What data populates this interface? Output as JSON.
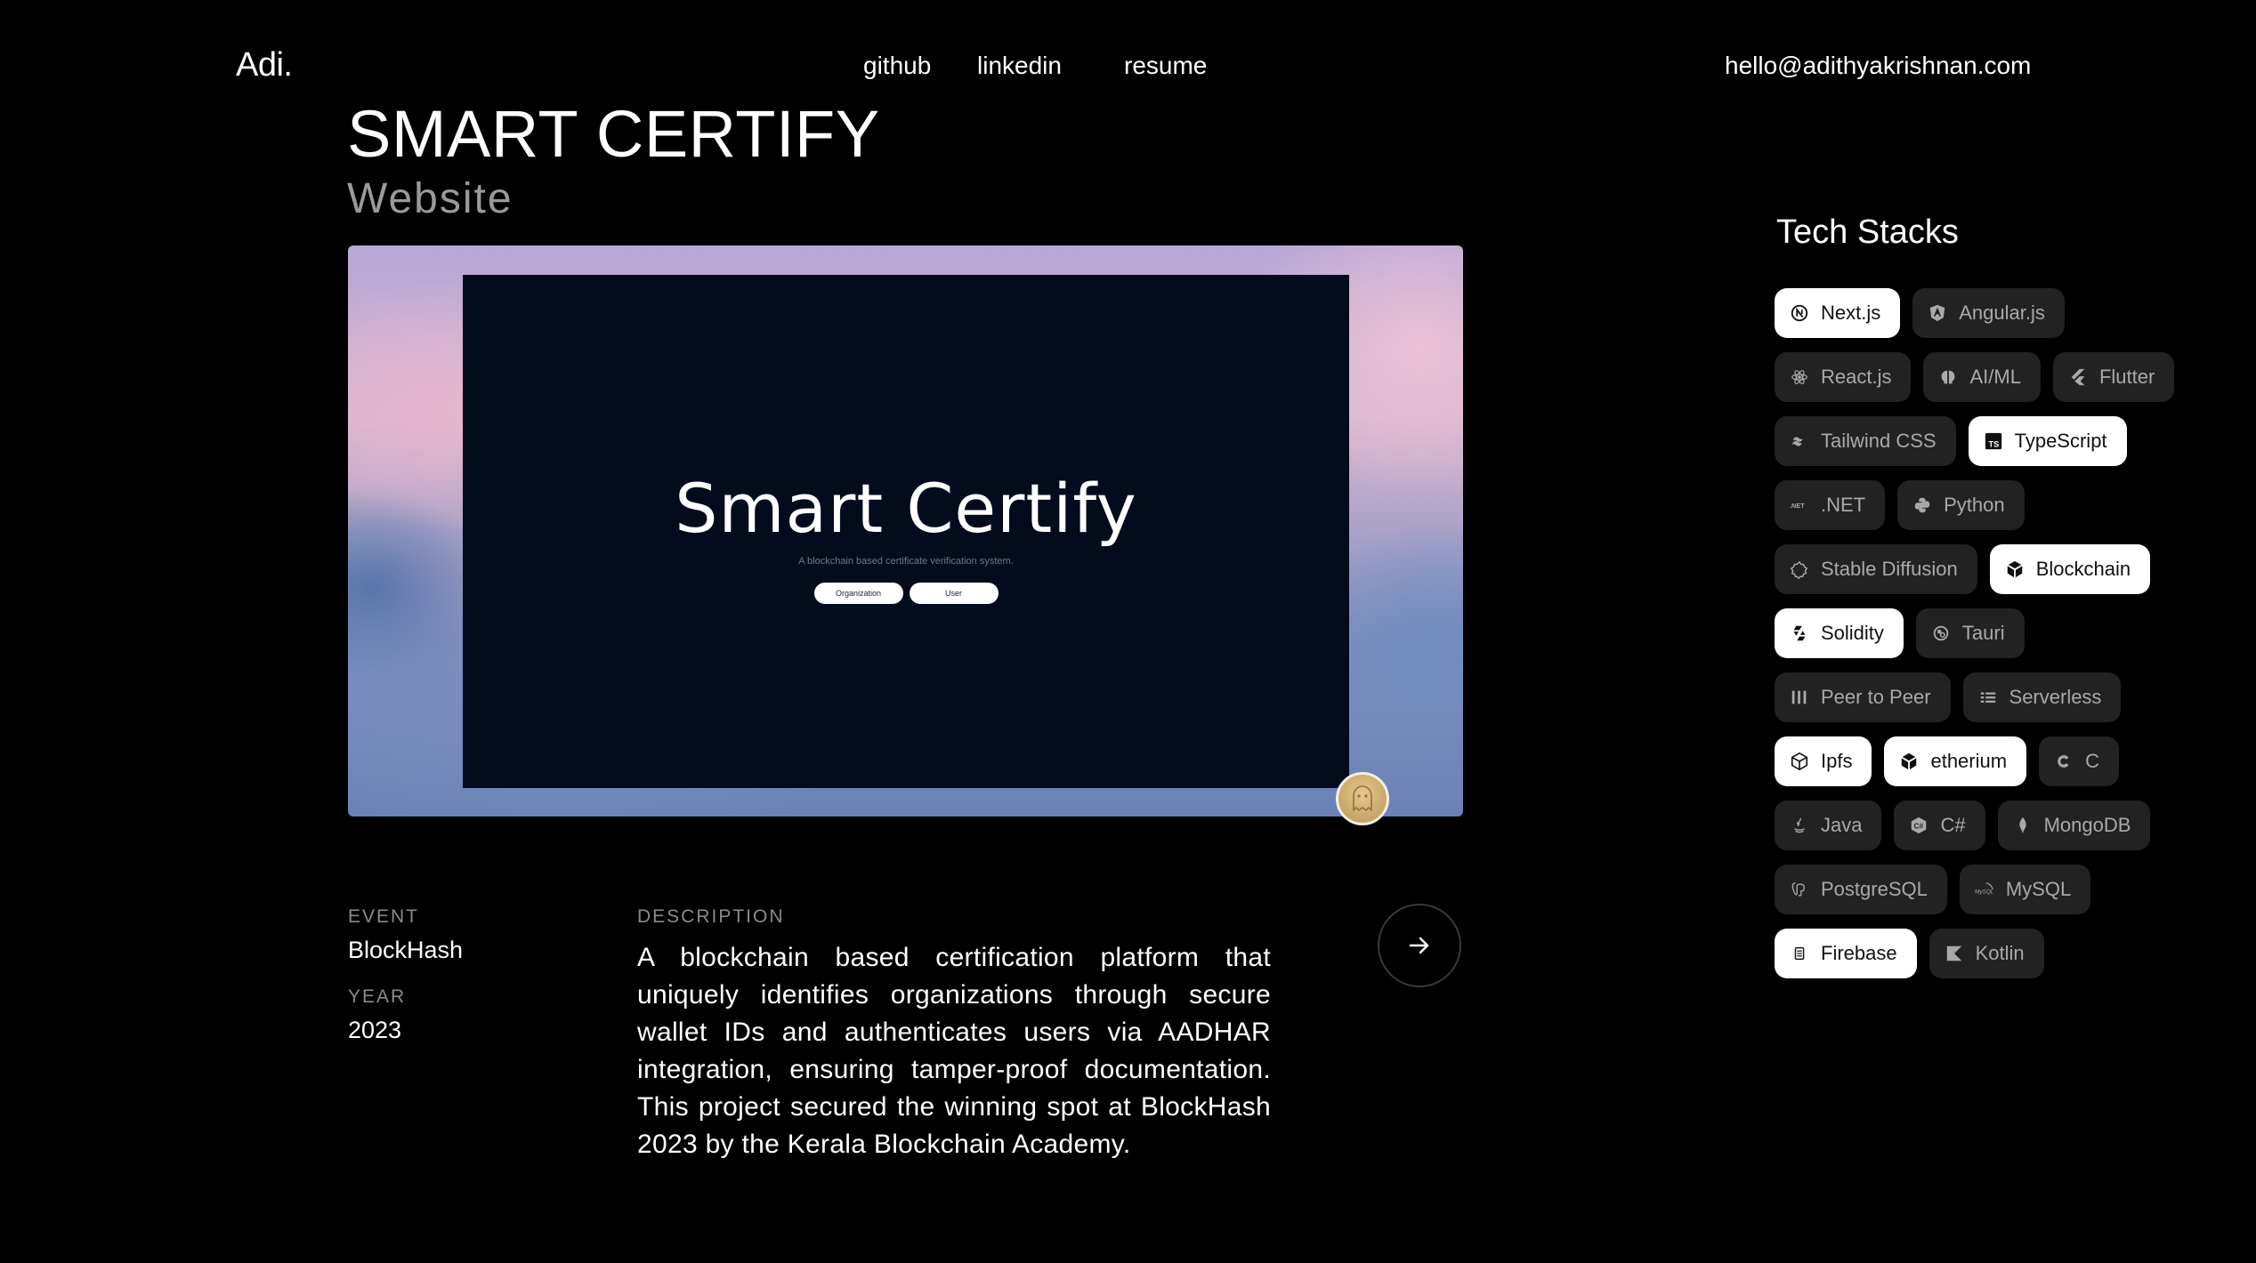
{
  "header": {
    "logo": "Adi.",
    "nav": [
      {
        "label": "github"
      },
      {
        "label": "linkedin"
      },
      {
        "label": "resume"
      }
    ],
    "email": "hello@adithyakrishnan.com"
  },
  "project": {
    "title": "SMART CERTIFY",
    "type": "Website",
    "preview": {
      "title": "Smart Certify",
      "subtitle": "A blockchain based certificate verification system.",
      "buttons": [
        "Organization",
        "User"
      ]
    },
    "event_label": "EVENT",
    "event": "BlockHash",
    "year_label": "YEAR",
    "year": "2023",
    "description_label": "DESCRIPTION",
    "description": "A blockchain based certification platform that uniquely identifies organizations through secure wallet IDs and authenticates users via AADHAR integration, ensuring tamper-proof documentation. This project secured the winning spot at BlockHash 2023 by the Kerala Blockchain Academy."
  },
  "tech_stacks": {
    "title": "Tech Stacks",
    "items": [
      {
        "label": "Next.js",
        "icon": "nextjs-icon",
        "active": true
      },
      {
        "label": "Angular.js",
        "icon": "angular-icon",
        "active": false
      },
      {
        "label": "React.js",
        "icon": "react-icon",
        "active": false
      },
      {
        "label": "AI/ML",
        "icon": "brain-icon",
        "active": false
      },
      {
        "label": "Flutter",
        "icon": "flutter-icon",
        "active": false
      },
      {
        "label": "Tailwind CSS",
        "icon": "tailwind-icon",
        "active": false
      },
      {
        "label": "TypeScript",
        "icon": "typescript-icon",
        "active": true
      },
      {
        "label": ".NET",
        "icon": "dotnet-icon",
        "active": false
      },
      {
        "label": "Python",
        "icon": "python-icon",
        "active": false
      },
      {
        "label": "Stable Diffusion",
        "icon": "stable-diffusion-icon",
        "active": false
      },
      {
        "label": "Blockchain",
        "icon": "blockchain-icon",
        "active": true
      },
      {
        "label": "Solidity",
        "icon": "solidity-icon",
        "active": true
      },
      {
        "label": "Tauri",
        "icon": "tauri-icon",
        "active": false
      },
      {
        "label": "Peer to Peer",
        "icon": "peer-to-peer-icon",
        "active": false
      },
      {
        "label": "Serverless",
        "icon": "serverless-icon",
        "active": false
      },
      {
        "label": "Ipfs",
        "icon": "ipfs-icon",
        "active": true
      },
      {
        "label": "etherium",
        "icon": "ethereum-icon",
        "active": true
      },
      {
        "label": "C",
        "icon": "c-icon",
        "active": false
      },
      {
        "label": "Java",
        "icon": "java-icon",
        "active": false
      },
      {
        "label": "C#",
        "icon": "csharp-icon",
        "active": false
      },
      {
        "label": "MongoDB",
        "icon": "mongodb-icon",
        "active": false
      },
      {
        "label": "PostgreSQL",
        "icon": "postgresql-icon",
        "active": false
      },
      {
        "label": "MySQL",
        "icon": "mysql-icon",
        "active": false
      },
      {
        "label": "Firebase",
        "icon": "firebase-icon",
        "active": true
      },
      {
        "label": "Kotlin",
        "icon": "kotlin-icon",
        "active": false
      }
    ]
  },
  "colors": {
    "background": "#000000",
    "chip_active_bg": "#ffffff",
    "chip_inactive_bg": "#222222",
    "muted_text": "#8a8a8a"
  }
}
